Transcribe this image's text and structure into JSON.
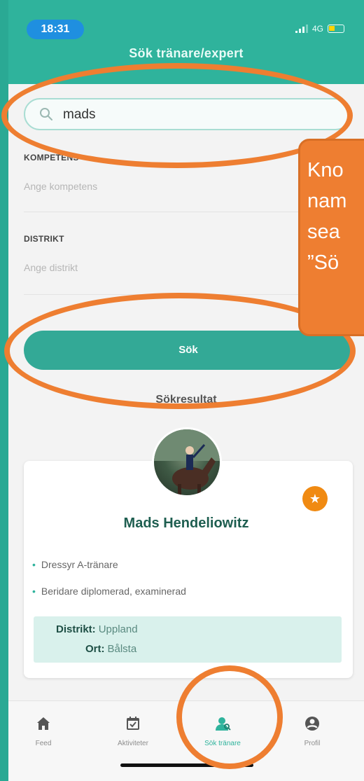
{
  "status_bar": {
    "time": "18:31",
    "network": "4G"
  },
  "header": {
    "title": "Sök tränare/expert"
  },
  "search": {
    "value": "mads"
  },
  "filters": {
    "competence_label": "KOMPETENS",
    "competence_placeholder": "Ange kompetens",
    "district_label": "DISTRIKT",
    "district_placeholder": "Ange distrikt"
  },
  "search_button_label": "Sök",
  "results": {
    "title": "Sökresultat",
    "card": {
      "name": "Mads Hendeliowitz",
      "qualifications": [
        "Dressyr A-tränare",
        "Beridare diplomerad, examinerad"
      ],
      "district_key": "Distrikt:",
      "district_value": "Uppland",
      "city_key": "Ort:",
      "city_value": "Bålsta"
    }
  },
  "tabbar": {
    "items": [
      {
        "label": "Feed",
        "icon": "home-icon"
      },
      {
        "label": "Aktiviteter",
        "icon": "calendar-check-icon"
      },
      {
        "label": "Sök tränare",
        "icon": "search-trainer-icon"
      },
      {
        "label": "Profil",
        "icon": "profile-icon"
      }
    ],
    "active": "Sök tränare"
  },
  "annotation": {
    "lines": [
      "Kno",
      "nam",
      "sea",
      "”Sö"
    ]
  },
  "colors": {
    "accent": "#2fb39c",
    "annotation": "#ee7e31",
    "favorite": "#f08a12"
  }
}
